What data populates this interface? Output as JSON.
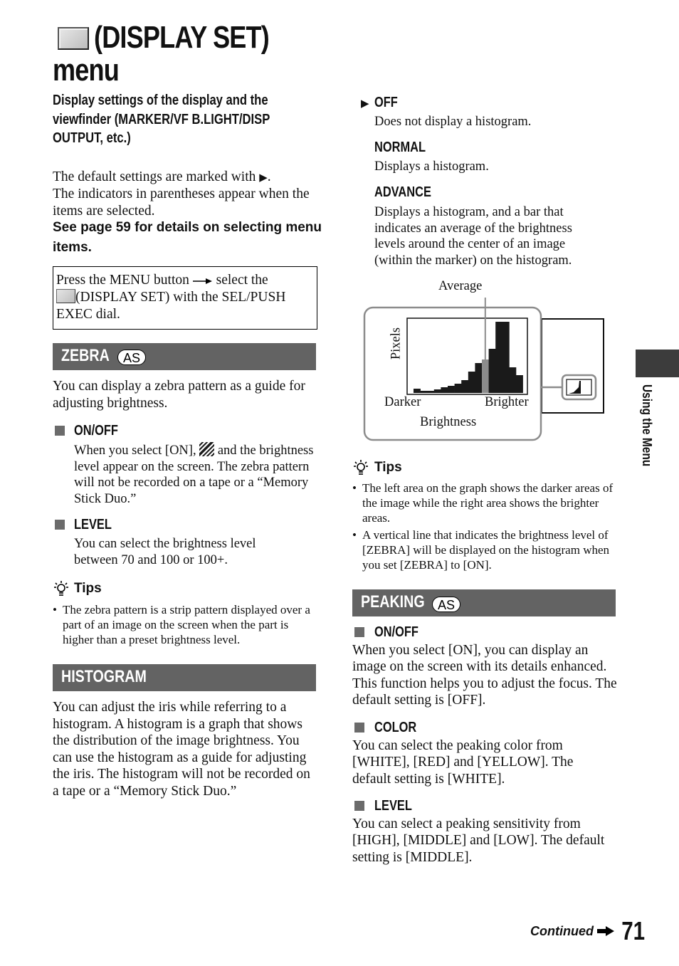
{
  "header": {
    "title_line1": "(DISPLAY SET)",
    "title_line2": "menu",
    "title_icon": "display-set-icon",
    "subtitle": "Display settings of the display and the viewfinder (MARKER/VF B.LIGHT/DISP OUTPUT, etc.)"
  },
  "intro": {
    "line1": "The default settings are marked with",
    "default_marker": "▶",
    "line1_end": ".",
    "line2": "The indicators in parentheses appear when the items are selected.",
    "see_page": "See page 59 for details on selecting menu items."
  },
  "menu_box": {
    "part1": "Press the MENU button",
    "arrow": "arrow-right-icon",
    "part2": "select the",
    "part3": "(DISPLAY SET) with the SEL/PUSH EXEC dial."
  },
  "zebra": {
    "title": "ZEBRA",
    "badge": "AS",
    "description": "You can display a zebra pattern as a guide for adjusting brightness.",
    "items": [
      {
        "head": "ON/OFF",
        "text_before": "When you select [ON],",
        "text_after": "and the brightness level appear on the screen. The zebra pattern will not be recorded on a tape or a “Memory Stick Duo.”"
      },
      {
        "head": "LEVEL",
        "text": "You can select the brightness level between 70 and 100 or 100+."
      }
    ],
    "tips_label": "Tips",
    "tips": [
      "The zebra pattern is a strip pattern displayed over a part of an image on the screen when the part is higher than a preset brightness level."
    ]
  },
  "histogram": {
    "title": "HISTOGRAM",
    "description": "You can adjust the iris while referring to a histogram. A histogram is a graph that shows the distribution of the image brightness. You can use the histogram as a guide for adjusting the iris. The histogram will not be recorded on a tape or a “Memory Stick Duo.”",
    "options": [
      {
        "marker": "▶",
        "head": "OFF",
        "text": "Does not display a histogram.",
        "default": true
      },
      {
        "marker": "",
        "head": "NORMAL",
        "text": "Displays a histogram."
      },
      {
        "marker": "",
        "head": "ADVANCE",
        "text": "Displays a histogram, and a bar that indicates an average of the brightness levels around the center of an image (within the marker) on the histogram."
      }
    ],
    "diagram": {
      "average_label": "Average",
      "y_label": "Pixels",
      "x_left": "Darker",
      "x_right": "Brighter",
      "x_label": "Brightness"
    },
    "tips_label": "Tips",
    "tips": [
      "The left area on the graph shows the darker areas of the image while the right area shows the brighter areas.",
      "A vertical line that indicates the brightness level of [ZEBRA] will be displayed on the histogram when you set [ZEBRA] to [ON]."
    ]
  },
  "chart_data": {
    "type": "bar",
    "title": "",
    "xlabel": "Brightness",
    "ylabel": "Pixels",
    "x_tick_labels": [
      "Darker",
      "Brighter"
    ],
    "annotation": "Average",
    "average_bin_index": 10,
    "values": [
      6,
      3,
      3,
      5,
      8,
      10,
      13,
      18,
      30,
      42,
      47,
      62,
      100,
      100,
      36,
      25
    ],
    "ylim": [
      0,
      100
    ],
    "colors": {
      "bars": "#1a1a1a",
      "average": "#8c8c8c"
    }
  },
  "peaking": {
    "title": "PEAKING",
    "badge": "AS",
    "items": [
      {
        "head": "ON/OFF",
        "text": "When you select [ON], you can display an image on the screen with its details enhanced. This function helps you to adjust the focus. The default setting is [OFF]."
      },
      {
        "head": "COLOR",
        "text": "You can select the peaking color from [WHITE], [RED] and [YELLOW]. The default setting is [WHITE]."
      },
      {
        "head": "LEVEL",
        "text": "You can select a peaking sensitivity from [HIGH], [MIDDLE] and [LOW]. The default setting is [MIDDLE]."
      }
    ]
  },
  "footer": {
    "continued": "Continued",
    "page_number": "71",
    "side_label": "Using the Menu"
  },
  "colors": {
    "section_bar": "#636363",
    "bullet_square": "#6b6b6b",
    "side_tab": "#3c3c3c"
  }
}
